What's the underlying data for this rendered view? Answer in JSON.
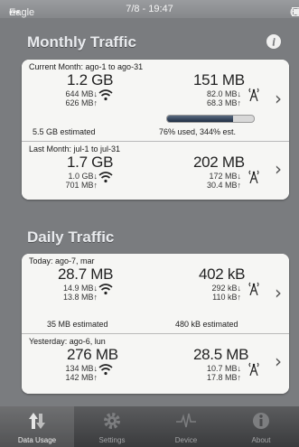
{
  "status_bar": {
    "carrier": "Eagle",
    "time": "7/8 - 19:47",
    "battery": "60%"
  },
  "monthly": {
    "title": "Monthly Traffic",
    "current": {
      "title": "Current Month: ago-1 to ago-31",
      "wifi_total": "1.2 GB",
      "wifi_down": "644 MB↓",
      "wifi_up": "626 MB↑",
      "cell_total": "151 MB",
      "cell_down": "82.0 MB↓",
      "cell_up": "68.3 MB↑",
      "wifi_estimated": "5.5 GB estimated",
      "usage_text": "76% used, 344% est.",
      "usage_fraction": 0.76
    },
    "last": {
      "title": "Last Month: jul-1 to jul-31",
      "wifi_total": "1.7 GB",
      "wifi_down": "1.0 GB↓",
      "wifi_up": "701 MB↑",
      "cell_total": "202 MB",
      "cell_down": "172 MB↓",
      "cell_up": "30.4 MB↑"
    }
  },
  "daily": {
    "title": "Daily Traffic",
    "today": {
      "title": "Today: ago-7, mar",
      "wifi_total": "28.7 MB",
      "wifi_down": "14.9 MB↓",
      "wifi_up": "13.8 MB↑",
      "cell_total": "402 kB",
      "cell_down": "292 kB↓",
      "cell_up": "110 kB↑",
      "wifi_estimated": "35 MB estimated",
      "cell_estimated": "480 kB estimated"
    },
    "yesterday": {
      "title": "Yesterday: ago-6, lun",
      "wifi_total": "276 MB",
      "wifi_down": "134 MB↓",
      "wifi_up": "142 MB↑",
      "cell_total": "28.5 MB",
      "cell_down": "10.7 MB↓",
      "cell_up": "17.8 MB↑"
    }
  },
  "tabs": [
    {
      "label": "Data Usage",
      "icon": "data-usage-icon",
      "active": true
    },
    {
      "label": "Settings",
      "icon": "gear-icon",
      "active": false
    },
    {
      "label": "Device",
      "icon": "pulse-icon",
      "active": false
    },
    {
      "label": "About",
      "icon": "info-icon",
      "active": false
    }
  ],
  "colors": {
    "background": "#7a7c7f",
    "card": "#f6f6f4",
    "progress_fill": "#1f2e44"
  }
}
